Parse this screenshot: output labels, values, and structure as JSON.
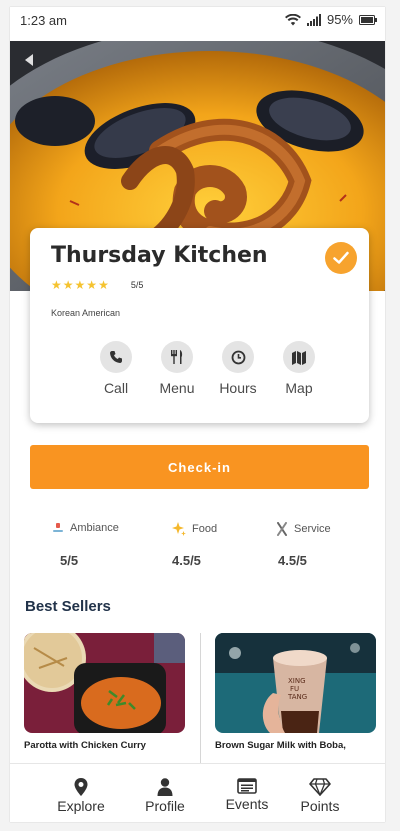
{
  "status_bar": {
    "time": "1:23 am",
    "battery": "95%",
    "icons": [
      "wifi-icon",
      "signal-icon",
      "battery-icon"
    ]
  },
  "hero": {
    "back_icon": "back-arrow-icon"
  },
  "restaurant": {
    "name": "Thursday Kitchen",
    "rating_text": "5/5",
    "stars": 5,
    "cuisine": "Korean American",
    "verified_icon": "check-badge-icon"
  },
  "actions": [
    {
      "label": "Call",
      "icon": "phone-icon"
    },
    {
      "label": "Menu",
      "icon": "fork-knife-icon"
    },
    {
      "label": "Hours",
      "icon": "clock-icon"
    },
    {
      "label": "Map",
      "icon": "map-icon"
    }
  ],
  "checkin": {
    "label": "Check-in"
  },
  "ratings": [
    {
      "label": "Ambiance",
      "value": "5/5",
      "icon": "ambiance-icon"
    },
    {
      "label": "Food",
      "value": "4.5/5",
      "icon": "sparkle-icon"
    },
    {
      "label": "Service",
      "value": "4.5/5",
      "icon": "utensils-cross-icon"
    }
  ],
  "best_sellers": {
    "title": "Best Sellers",
    "items": [
      {
        "name": "Parotta with Chicken Curry"
      },
      {
        "name": "Brown Sugar Milk with Boba,"
      }
    ]
  },
  "bottom_nav": [
    {
      "label": "Explore",
      "icon": "location-pin-icon"
    },
    {
      "label": "Profile",
      "icon": "user-icon"
    },
    {
      "label": "Events",
      "icon": "events-icon"
    },
    {
      "label": "Points",
      "icon": "diamond-icon"
    }
  ],
  "colors": {
    "accent": "#f99421",
    "verified": "#f7a32e",
    "star": "#f5c330",
    "title": "#22334a"
  }
}
